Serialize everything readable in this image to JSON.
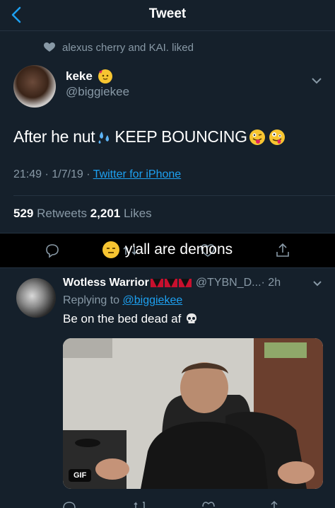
{
  "header": {
    "title": "Tweet"
  },
  "social_context": {
    "text": "alexus cherry and KAI. liked"
  },
  "tweet": {
    "name": "keke",
    "handle": "@biggiekee",
    "text_before": "After he nut",
    "text_after": "KEEP BOUNCING",
    "time": "21:49 · 1/7/19 · ",
    "source": "Twitter for iPhone",
    "retweets_count": "529",
    "retweets_label": " Retweets  ",
    "likes_count": "2,201",
    "likes_label": " Likes"
  },
  "caption_overlay": {
    "text": "y'all are demons"
  },
  "reply": {
    "name": "Wotless Warrior",
    "handle": "@TYBN_D...",
    "time": " · 2h",
    "replying_prefix": "Replying to ",
    "replying_handle": "@biggiekee",
    "text": "Be on the bed dead af",
    "media_badge": "GIF"
  },
  "colors": {
    "background": "#15202b",
    "accent": "#1da1f2",
    "muted": "#8899a6"
  }
}
